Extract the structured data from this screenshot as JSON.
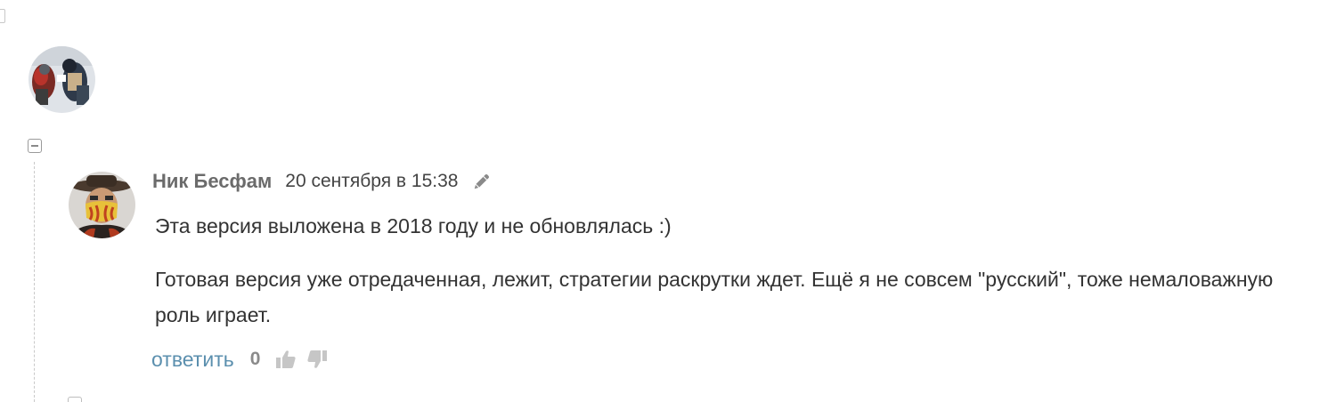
{
  "parent_comment": {
    "avatar_icon": "user-avatar"
  },
  "thread": {
    "toggle_icon": "collapse-minus-icon"
  },
  "comment": {
    "author": "Ник Бесфам",
    "timestamp": "20 сентября в 15:38",
    "edit_icon": "pencil-icon",
    "avatar_icon": "user-avatar",
    "paragraphs": [
      "Эта версия выложена в 2018 году и не обновлялась :)",
      "Готовая версия уже отредаченная, лежит, стратегии раскрутки ждет. Ещё я не совсем \"русский\", тоже немаловажную роль играет."
    ],
    "actions": {
      "reply_label": "ответить",
      "score": "0",
      "upvote_icon": "thumbs-up-icon",
      "downvote_icon": "thumbs-down-icon"
    }
  },
  "colors": {
    "author": "#6b6b6b",
    "link": "#5b8fae",
    "text": "#333333",
    "muted": "#8a8a8a"
  }
}
